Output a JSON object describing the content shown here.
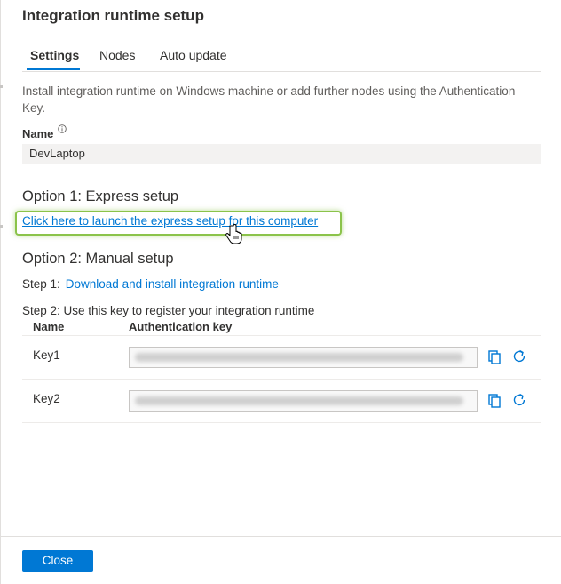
{
  "dialog": {
    "title": "Integration runtime setup"
  },
  "tabs": [
    {
      "label": "Settings",
      "active": true
    },
    {
      "label": "Nodes",
      "active": false
    },
    {
      "label": "Auto update",
      "active": false
    }
  ],
  "settings": {
    "description": "Install integration runtime on Windows machine or add further nodes using the Authentication Key.",
    "name_label": "Name",
    "name_value": "DevLaptop",
    "option1_heading": "Option 1: Express setup",
    "express_link": "Click here to launch the express setup for this computer",
    "option2_heading": "Option 2: Manual setup",
    "step1_label": "Step 1:",
    "step1_link": "Download and install integration runtime",
    "step2_label": "Step 2: Use this key to register your integration runtime",
    "table": {
      "headers": [
        "Name",
        "Authentication key"
      ],
      "rows": [
        {
          "name": "Key1",
          "value_obscured": true
        },
        {
          "name": "Key2",
          "value_obscured": true
        }
      ]
    }
  },
  "footer": {
    "close_label": "Close"
  },
  "icons": {
    "info": "info-icon",
    "copy": "copy-icon",
    "refresh": "refresh-icon",
    "cursor": "hand-pointer-icon"
  },
  "colors": {
    "accent": "#0078d4",
    "highlight": "#8bc34a"
  }
}
